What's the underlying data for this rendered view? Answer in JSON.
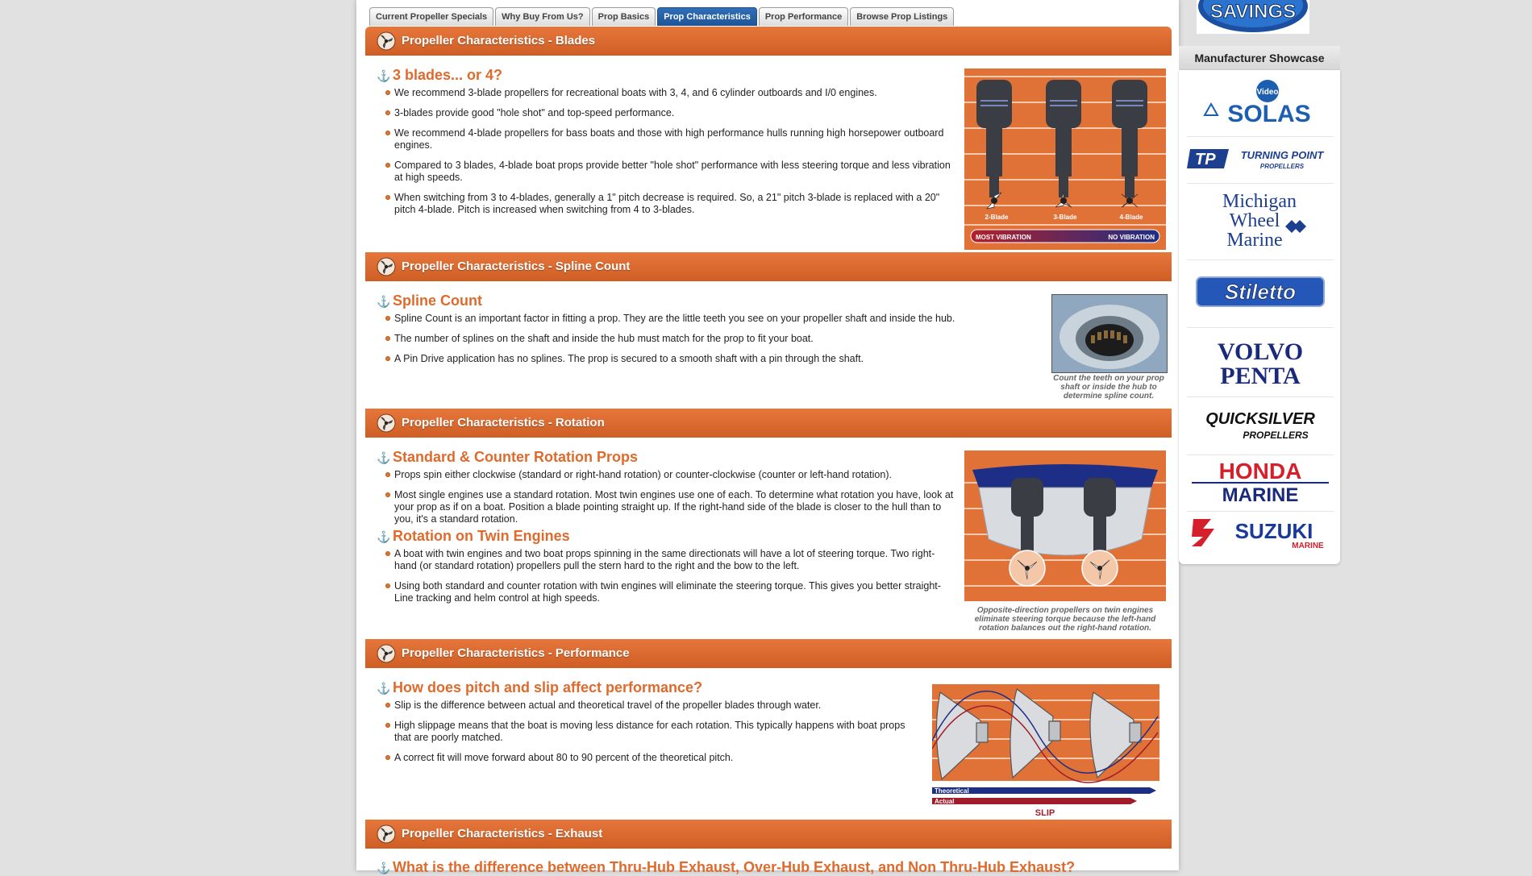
{
  "tabs": [
    {
      "label": "Current Propeller Specials"
    },
    {
      "label": "Why Buy From Us?"
    },
    {
      "label": "Prop Basics"
    },
    {
      "label": "Prop Characteristics"
    },
    {
      "label": "Prop Performance"
    },
    {
      "label": "Browse Prop Listings"
    }
  ],
  "sections": {
    "blades": {
      "title": "Propeller Characteristics - Blades",
      "heading": "3 blades... or 4?",
      "bullets": [
        "We recommend 3-blade propellers for recreational boats with 3, 4, and 6 cylinder outboards and I/0 engines.",
        "3-blades provide good \"hole shot\" and top-speed performance.",
        "We recommend 4-blade propellers for bass boats and those with high performance hulls running high horsepower outboard engines.",
        "Compared to 3 blades, 4-blade boat props provide better \"hole shot\" performance with less steering torque and less vibration at high speeds.",
        "When switching from 3 to 4-blades, generally a 1\" pitch decrease is required. So, a 21\" pitch 3-blade is replaced with a 20\" pitch 4-blade. Pitch is increased when switching from 4 to 3-blades."
      ],
      "figure": {
        "labels": [
          "2-Blade",
          "3-Blade",
          "4-Blade"
        ],
        "bar_left": "MOST VIBRATION",
        "bar_right": "NO VIBRATION"
      }
    },
    "spline": {
      "title": "Propeller Characteristics - Spline Count",
      "heading": "Spline Count",
      "bullets": [
        "Spline Count is an important factor in fitting a prop. They are the little teeth you see on your propeller shaft and inside the hub.",
        "The number of splines on the shaft and inside the hub must match for the prop to fit your boat.",
        "A Pin Drive application has no splines. The prop is secured to a smooth shaft with a pin through the shaft."
      ],
      "caption": "Count the teeth on your prop shaft or inside the hub to determine spline count."
    },
    "rotation": {
      "title": "Propeller Characteristics - Rotation",
      "heading": "Standard & Counter Rotation Props",
      "bullets": [
        "Props spin either clockwise (standard or right-hand rotation) or counter-clockwise (counter or left-hand rotation).",
        "Most single engines use a standard rotation. Most twin engines use one of each. To determine what rotation you have, look at your prop as if on a boat. Position a blade pointing straight up. If the right-hand side of the blade is closer to the hull than to you, it's a standard rotation."
      ],
      "heading2": "Rotation on Twin Engines",
      "bullets2": [
        "A boat with twin engines and two boat props spinning in the same directionats will have a lot of steering torque. Two right-hand (or standard rotation) propellers pull the stern hard to the right and the bow to the left.",
        "Using both standard and counter rotation with twin engines will eliminate the steering torque. This gives you better straight-Line tracking and helm control at high speeds."
      ],
      "caption": "Opposite-direction propellers on twin engines eliminate steering torque because the left-hand rotation balances out the right-hand rotation."
    },
    "performance": {
      "title": "Propeller Characteristics - Performance",
      "heading": "How does pitch and slip affect performance?",
      "bullets": [
        "Slip is the difference between actual and theoretical travel of the propeller blades through water.",
        "High slippage means that the boat is moving less distance for each rotation. This typically happens with boat props that are poorly matched.",
        "A correct fit will move forward about 80 to 90 percent of the theoretical pitch."
      ],
      "figure": {
        "theoretical": "Theoretical",
        "actual": "Actual",
        "slip": "SLIP"
      }
    },
    "exhaust": {
      "title": "Propeller Characteristics - Exhaust",
      "heading": "What is the difference between Thru-Hub Exhaust, Over-Hub Exhaust, and Non Thru-Hub Exhaust?"
    }
  },
  "sidebar": {
    "savings_text": "SAVINGS",
    "showcase_title": "Manufacturer Showcase",
    "brands": [
      {
        "name": "SOLAS",
        "badge": "Video"
      },
      {
        "name": "TURNING POINT",
        "sub": "PROPELLERS"
      },
      {
        "name": "Michigan Wheel Marine",
        "lines": [
          "Michigan",
          "Wheel",
          "Marine"
        ]
      },
      {
        "name": "Stiletto"
      },
      {
        "name": "VOLVO PENTA",
        "lines": [
          "VOLVO",
          "PENTA"
        ]
      },
      {
        "name": "QUICKSILVER",
        "sub": "PROPELLERS"
      },
      {
        "name": "HONDA MARINE",
        "lines": [
          "HONDA",
          "MARINE"
        ]
      },
      {
        "name": "SUZUKI",
        "sub": "MARINE"
      }
    ]
  },
  "colors": {
    "accent": "#e06a2c",
    "header": "#d9652b",
    "tab_active": "#1f5496",
    "navy": "#1a2a7a"
  }
}
